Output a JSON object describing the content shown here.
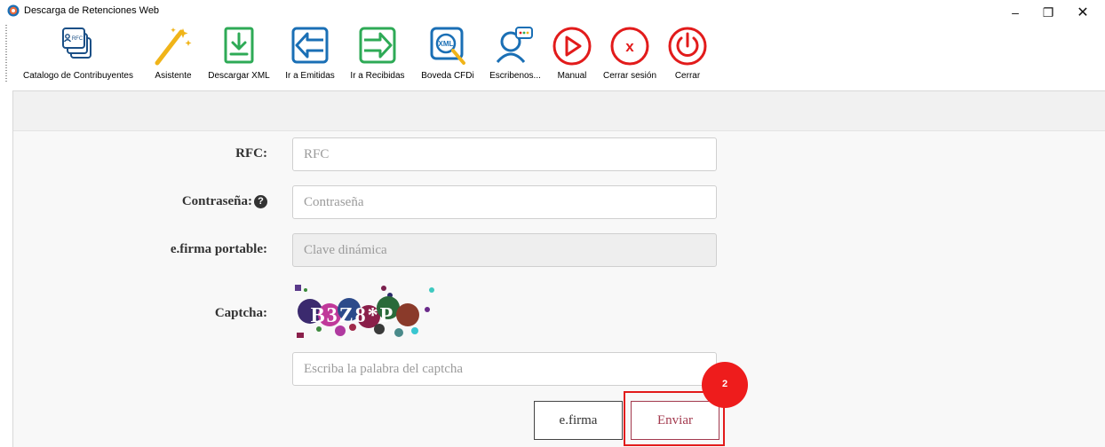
{
  "window": {
    "title": "Descarga de Retenciones Web",
    "controls": {
      "minimize": "–",
      "restore": "❐",
      "close": "✕"
    }
  },
  "toolbar": {
    "items": [
      {
        "label": "Catalogo de Contribuyentes",
        "icon": "contribuyentes-rfc-icon",
        "icon_text": "RFC",
        "color": "#1a6fb5"
      },
      {
        "label": "Asistente",
        "icon": "magic-wand-icon",
        "color": "#f0b419"
      },
      {
        "label": "Descargar XML",
        "icon": "download-icon",
        "color": "#2eaa56"
      },
      {
        "label": "Ir a Emitidas",
        "icon": "arrow-left-icon",
        "color": "#1a6fb5"
      },
      {
        "label": "Ir a Recibidas",
        "icon": "arrow-right-icon",
        "color": "#2eaa56"
      },
      {
        "label": "Boveda CFDi",
        "icon": "xml-search-icon",
        "icon_text": "XML",
        "color": "#1a6fb5"
      },
      {
        "label": "Escribenos...",
        "icon": "chat-user-icon",
        "color": "#1a6fb5"
      },
      {
        "label": "Manual",
        "icon": "play-icon",
        "color": "#e21b1b"
      },
      {
        "label": "Cerrar sesión",
        "icon": "logout-x-icon",
        "icon_text": "x",
        "color": "#e21b1b"
      },
      {
        "label": "Cerrar",
        "icon": "power-icon",
        "color": "#e21b1b"
      }
    ]
  },
  "form": {
    "rfc": {
      "label": "RFC:",
      "placeholder": "RFC"
    },
    "password": {
      "label": "Contraseña:",
      "placeholder": "Contraseña"
    },
    "efirma_portable": {
      "label": "e.firma portable:",
      "placeholder": "Clave dinámica"
    },
    "captcha": {
      "label": "Captcha:",
      "image_text": "B3Z8*P",
      "input_placeholder": "Escriba la palabra del captcha"
    },
    "buttons": {
      "efirma": "e.firma",
      "enviar": "Enviar"
    }
  },
  "annotation": {
    "step_badge": "2",
    "color": "#e21b1b"
  }
}
